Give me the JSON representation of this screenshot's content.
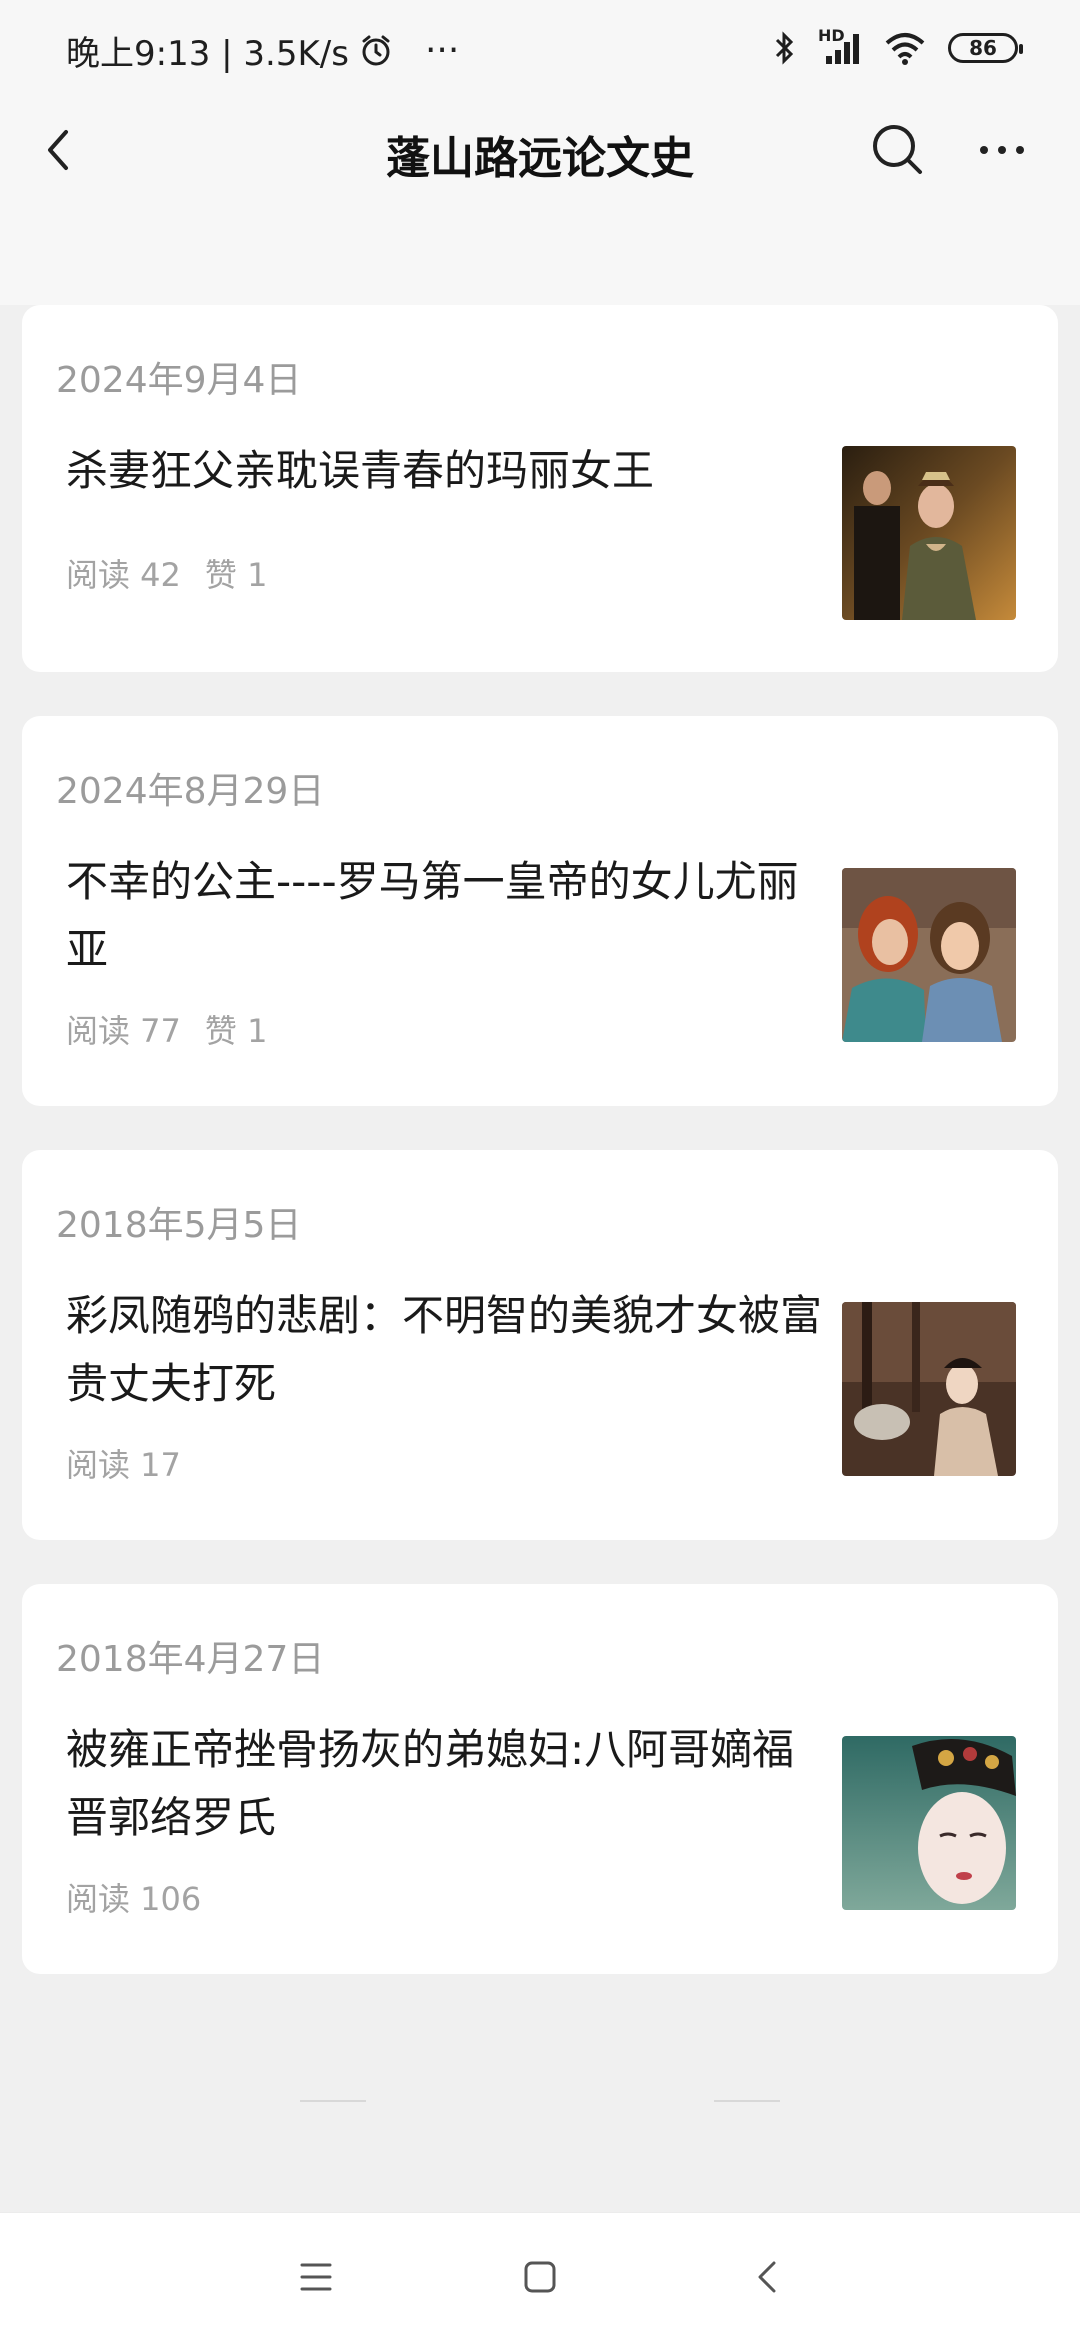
{
  "status": {
    "time": "晚上9:13 | 3.5K/s",
    "dots": "···",
    "hd": "HD",
    "battery": "86"
  },
  "header": {
    "title": "蓬山路远论文史"
  },
  "articles": [
    {
      "date": "2024年9月4日",
      "title": "杀妻狂父亲耽误青春的玛丽女王",
      "reads": "阅读 42",
      "likes": "赞 1"
    },
    {
      "date": "2024年8月29日",
      "title": "不幸的公主----罗马第一皇帝的女儿尤丽亚",
      "reads": "阅读 77",
      "likes": "赞 1"
    },
    {
      "date": "2018年5月5日",
      "title": "彩凤随鸦的悲剧：不明智的美貌才女被富贵丈夫打死",
      "reads": "阅读 17",
      "likes": ""
    },
    {
      "date": "2018年4月27日",
      "title": "被雍正帝挫骨扬灰的弟媳妇:八阿哥嫡福晋郭络罗氏",
      "reads": "阅读 106",
      "likes": ""
    }
  ],
  "footer": {
    "text": ""
  },
  "colors": {
    "background": "#f0f0f0",
    "card": "#ffffff",
    "secondary_text": "#9b9b9b"
  },
  "icons": [
    "back-icon",
    "search-icon",
    "more-icon",
    "menu-icon",
    "home-icon",
    "back-nav-icon"
  ]
}
